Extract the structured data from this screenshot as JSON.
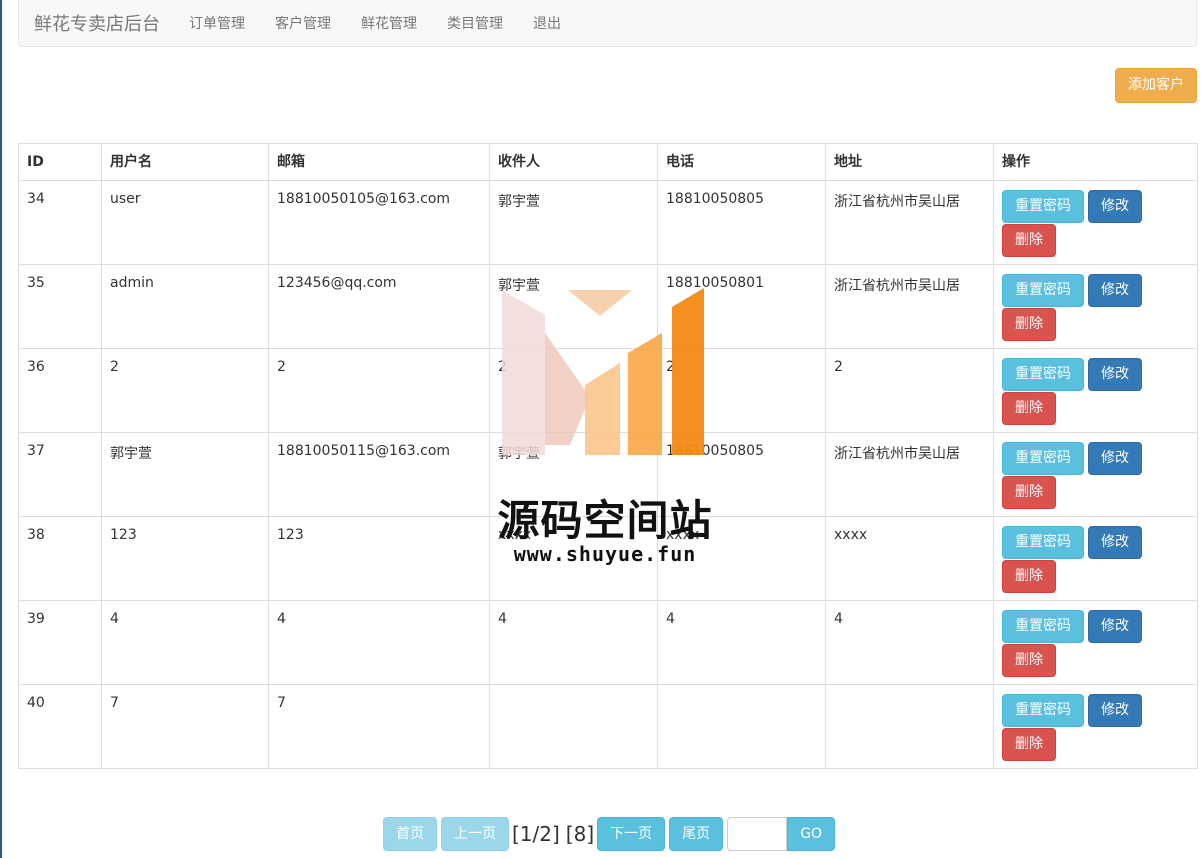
{
  "navbar": {
    "brand": "鲜花专卖店后台",
    "items": [
      "订单管理",
      "客户管理",
      "鲜花管理",
      "类目管理",
      "退出"
    ]
  },
  "add_button": "添加客户",
  "table": {
    "headers": [
      "ID",
      "用户名",
      "邮箱",
      "收件人",
      "电话",
      "地址",
      "操作"
    ],
    "rows": [
      {
        "id": "34",
        "username": "user",
        "email": "18810050105@163.com",
        "recipient": "郭宇萱",
        "phone": "18810050805",
        "address": "浙江省杭州市吴山居"
      },
      {
        "id": "35",
        "username": "admin",
        "email": "123456@qq.com",
        "recipient": "郭宇萱",
        "phone": "18810050801",
        "address": "浙江省杭州市吴山居"
      },
      {
        "id": "36",
        "username": "2",
        "email": "2",
        "recipient": "2",
        "phone": "2",
        "address": "2"
      },
      {
        "id": "37",
        "username": "郭宇萱",
        "email": "18810050115@163.com",
        "recipient": "郭宇萱",
        "phone": "18810050805",
        "address": "浙江省杭州市吴山居"
      },
      {
        "id": "38",
        "username": "123",
        "email": "123",
        "recipient": "xxxx",
        "phone": "xxxx",
        "address": "xxxx"
      },
      {
        "id": "39",
        "username": "4",
        "email": "4",
        "recipient": "4",
        "phone": "4",
        "address": "4"
      },
      {
        "id": "40",
        "username": "7",
        "email": "7",
        "recipient": "",
        "phone": "",
        "address": ""
      }
    ],
    "actions": {
      "reset_password": "重置密码",
      "edit": "修改",
      "delete": "删除"
    }
  },
  "watermark": {
    "title": "源码空间站",
    "url": "www.shuyue.fun"
  },
  "pagination": {
    "first": "首页",
    "prev": "上一页",
    "page_info": "[1/2]",
    "total": "[8]",
    "next": "下一页",
    "last": "尾页",
    "go": "GO",
    "page_input_value": ""
  },
  "colors": {
    "warning": "#f0ad4e",
    "info": "#5bc0de",
    "primary": "#337ab7",
    "danger": "#d9534f"
  }
}
